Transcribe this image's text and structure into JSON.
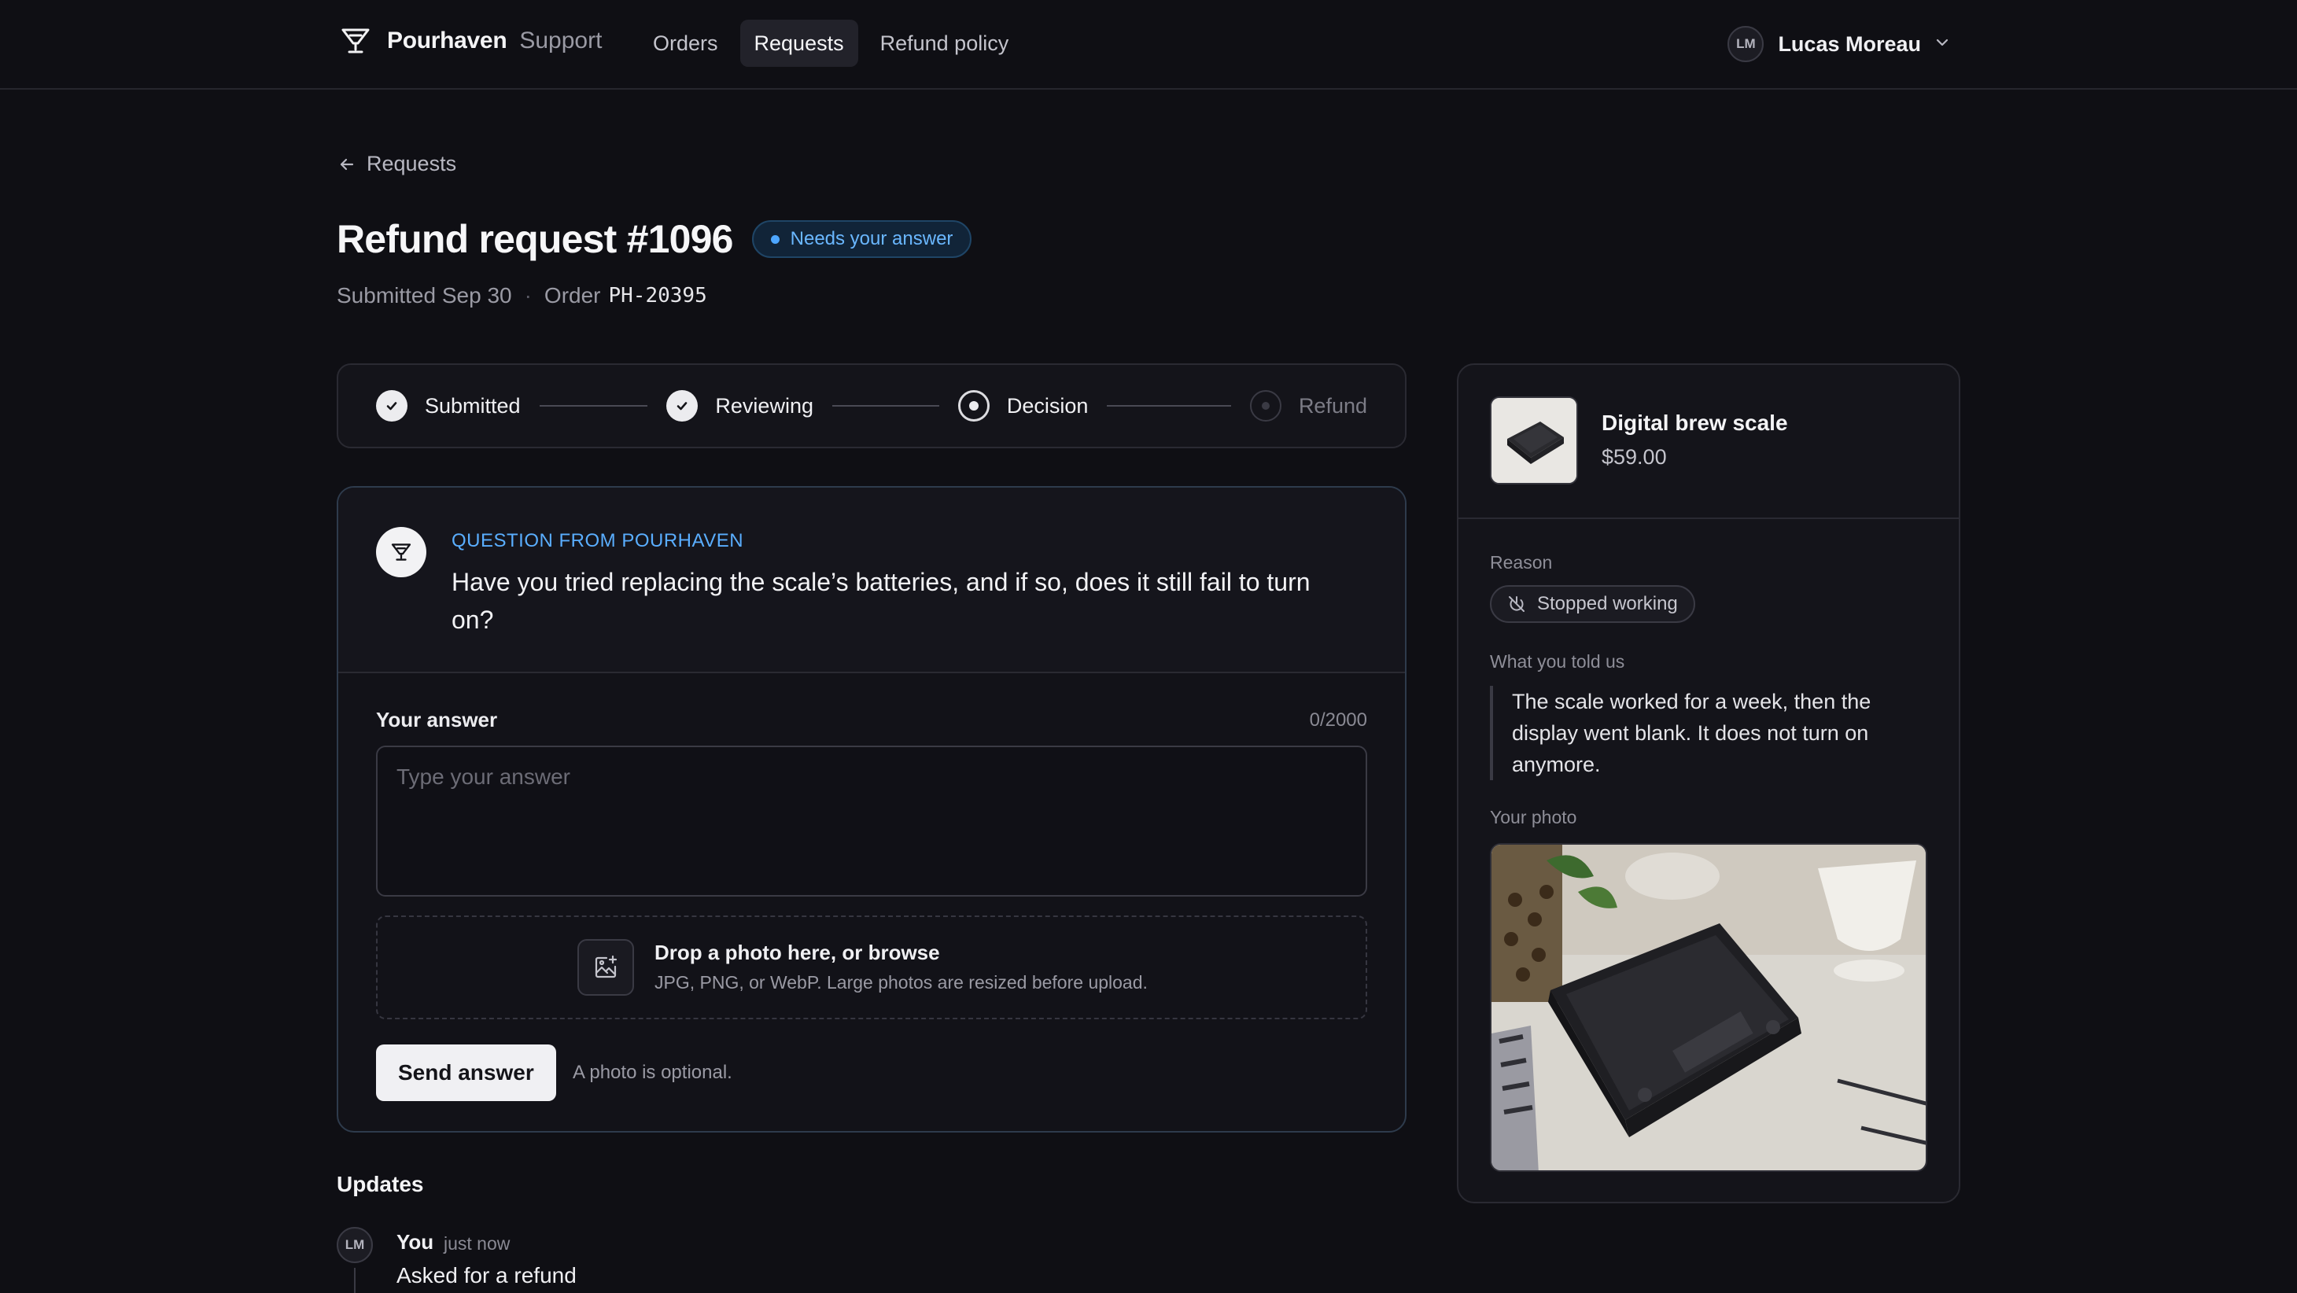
{
  "brand": {
    "name": "Pourhaven",
    "sub": "Support"
  },
  "nav": [
    {
      "label": "Orders",
      "active": false
    },
    {
      "label": "Requests",
      "active": true
    },
    {
      "label": "Refund policy",
      "active": false
    }
  ],
  "user": {
    "initials": "LM",
    "name": "Lucas Moreau"
  },
  "back_label": "Requests",
  "request": {
    "title": "Refund request #1096",
    "status": "Needs your answer",
    "submitted": "Submitted Sep 30",
    "order_label": "Order",
    "order_id": "PH-20395"
  },
  "steps": [
    {
      "label": "Submitted",
      "state": "done"
    },
    {
      "label": "Reviewing",
      "state": "done"
    },
    {
      "label": "Decision",
      "state": "current"
    },
    {
      "label": "Refund",
      "state": "upcoming"
    }
  ],
  "question": {
    "label": "QUESTION FROM POURHAVEN",
    "text": "Have you tried replacing the scale’s batteries, and if so, does it still fail to turn on?"
  },
  "answer": {
    "label": "Your answer",
    "count": "0/2000",
    "placeholder": "Type your answer",
    "value": ""
  },
  "dropzone": {
    "title": "Drop a photo here, or browse",
    "sub": "JPG, PNG, or WebP. Large photos are resized before upload."
  },
  "send": {
    "label": "Send answer",
    "note": "A photo is optional."
  },
  "updates": {
    "title": "Updates",
    "items": [
      {
        "initials": "LM",
        "who": "You",
        "time": "just now",
        "text": "Asked for a refund"
      }
    ]
  },
  "product": {
    "name": "Digital brew scale",
    "price": "$59.00"
  },
  "details": {
    "reason_label": "Reason",
    "reason": "Stopped working",
    "told_label": "What you told us",
    "told": "The scale worked for a week, then the display went blank. It does not turn on anymore.",
    "photo_label": "Your photo"
  },
  "colors": {
    "accent": "#5aaeff",
    "background": "#0f0f14",
    "badge_bg": "#112438"
  }
}
